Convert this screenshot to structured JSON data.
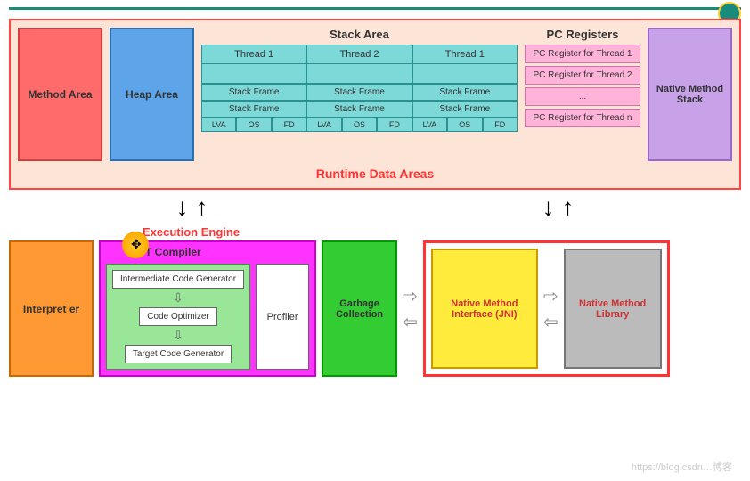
{
  "runtime": {
    "label": "Runtime Data Areas",
    "method_area": "Method Area",
    "heap_area": "Heap Area",
    "stack_title": "Stack Area",
    "threads": [
      "Thread 1",
      "Thread 2",
      "Thread 1"
    ],
    "stack_frame": "Stack Frame",
    "lva": "LVA",
    "os": "OS",
    "fd": "FD",
    "pc_title": "PC Registers",
    "pc_items": [
      "PC Register for Thread 1",
      "PC Register for Thread 2",
      "...",
      "PC Register for Thread n"
    ],
    "native_stack": "Native Method Stack"
  },
  "exec_label": "Execution Engine",
  "interpreter": "Interpret er",
  "jit": {
    "title": "T Compiler",
    "icg": "Intermediate Code Generator",
    "co": "Code Optimizer",
    "tcg": "Target Code Generator",
    "profiler": "Profiler"
  },
  "gc": "Garbage Collection",
  "jni": "Native Method Interface (JNI)",
  "nml": "Native Method Library",
  "watermark": "https://blog.csdn…博客"
}
